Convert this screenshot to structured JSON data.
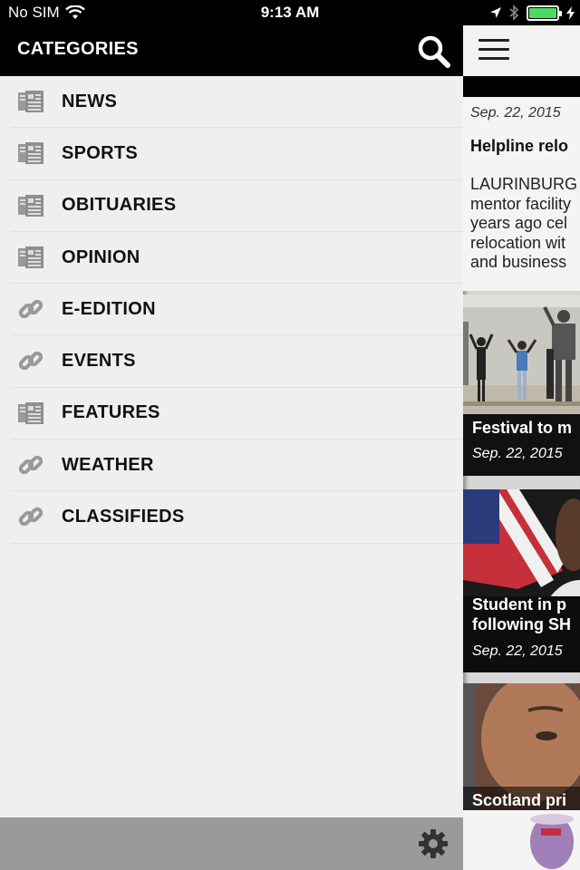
{
  "status_bar": {
    "carrier": "No SIM",
    "time": "9:13 AM"
  },
  "drawer": {
    "title": "CATEGORIES",
    "categories": [
      {
        "label": "NEWS",
        "icon": "document-icon"
      },
      {
        "label": "SPORTS",
        "icon": "document-icon"
      },
      {
        "label": "OBITUARIES",
        "icon": "document-icon"
      },
      {
        "label": "OPINION",
        "icon": "document-icon"
      },
      {
        "label": "E-EDITION",
        "icon": "link-icon"
      },
      {
        "label": "EVENTS",
        "icon": "link-icon"
      },
      {
        "label": "FEATURES",
        "icon": "document-icon"
      },
      {
        "label": "WEATHER",
        "icon": "link-icon"
      },
      {
        "label": "CLASSIFIEDS",
        "icon": "link-icon"
      }
    ]
  },
  "feed": {
    "articles": [
      {
        "date": "Sep. 22, 2015",
        "title": "Helpline relo",
        "excerpt": "LAURINBURG\nmentor facility\nyears ago cel\nrelocation wit\nand business"
      },
      {
        "title": "Festival to m",
        "date": "Sep. 22, 2015"
      },
      {
        "title": "Student in p\nfollowing SH",
        "date": "Sep. 22, 2015"
      },
      {
        "title": "Scotland pri"
      }
    ]
  },
  "colors": {
    "drawer_bg": "#efefef",
    "header_bg": "#000000",
    "footer_bg": "#9a9a9a",
    "battery": "#4cd964"
  }
}
